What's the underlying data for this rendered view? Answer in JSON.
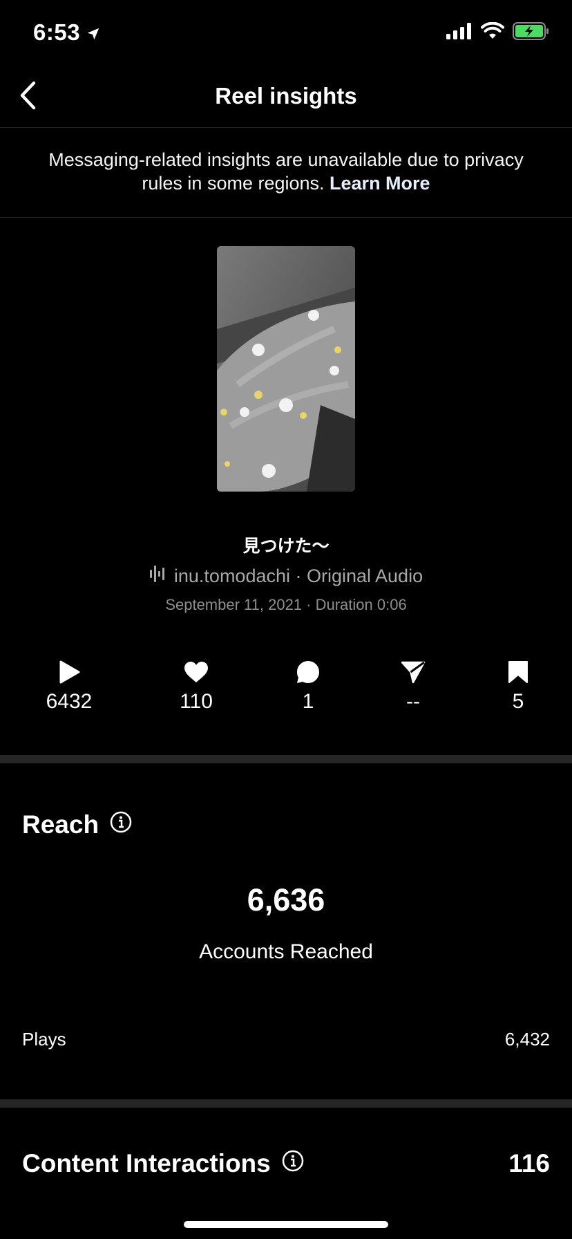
{
  "status_bar": {
    "time": "6:53"
  },
  "nav": {
    "title": "Reel insights"
  },
  "notice": {
    "text": "Messaging-related insights are unavailable due to privacy rules in some regions. ",
    "link": "Learn More"
  },
  "reel": {
    "caption": "見つけた〜",
    "audio": "inu.tomodachi · Original Audio",
    "meta": "September 11, 2021 · Duration 0:06"
  },
  "stats": {
    "plays": "6432",
    "likes": "110",
    "comments": "1",
    "shares": "--",
    "saves": "5"
  },
  "reach": {
    "title": "Reach",
    "accounts_reached": "6,636",
    "accounts_reached_label": "Accounts Reached",
    "plays_label": "Plays",
    "plays_value": "6,432"
  },
  "content_interactions": {
    "title": "Content Interactions",
    "value": "116"
  }
}
